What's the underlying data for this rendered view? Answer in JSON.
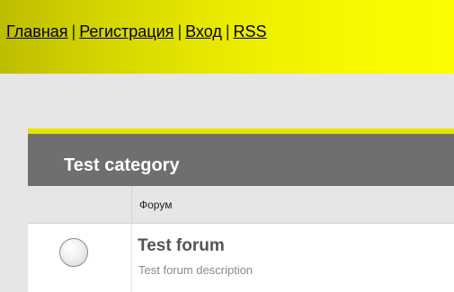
{
  "nav": {
    "items": [
      "Главная",
      "Регистрация",
      "Вход",
      "RSS"
    ],
    "separator": "|"
  },
  "category": {
    "title": "Test category",
    "column_header": "Форум"
  },
  "forum": {
    "title": "Test forum",
    "description": "Test forum description",
    "status_icon": "forum-status-circle-icon"
  },
  "colors": {
    "header_yellow": "#f6f600",
    "category_bar": "#6f6f6f",
    "accent_line": "#e3e300",
    "page_bg": "#e6e6e6"
  }
}
